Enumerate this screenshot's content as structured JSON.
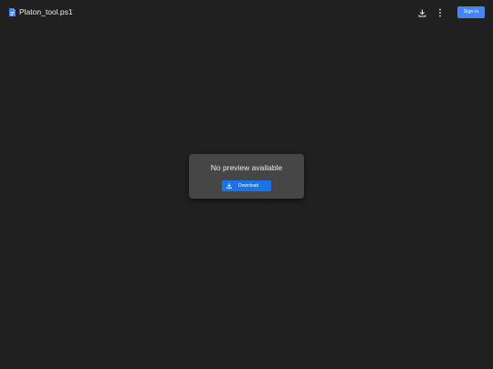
{
  "header": {
    "file_name": "Platon_tool.ps1",
    "file_icon": "document-icon",
    "download_icon": "download-icon",
    "more_icon": "more-vertical-icon",
    "sign_in_label": "Sign in"
  },
  "preview": {
    "message": "No preview available",
    "download_label": "Download",
    "download_icon": "download-icon"
  },
  "colors": {
    "background": "#202020",
    "card": "#464646",
    "accent": "#1a73e8",
    "sign_in": "#4285f4"
  }
}
